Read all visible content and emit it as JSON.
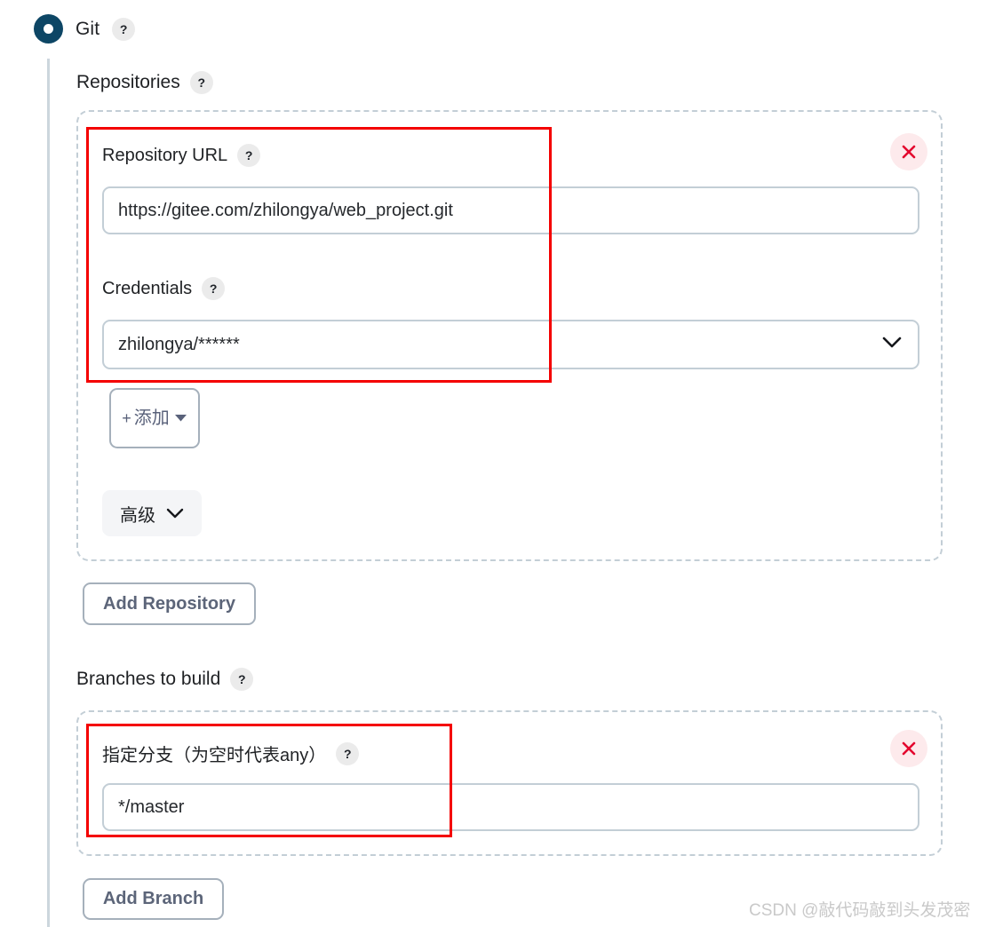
{
  "scm": {
    "selected_label": "Git",
    "help_label": "?",
    "radio_selected": true
  },
  "repositories": {
    "title": "Repositories",
    "help_label": "?",
    "repository": {
      "url_field": {
        "label": "Repository URL",
        "help_label": "?",
        "value": "https://gitee.com/zhilongya/web_project.git",
        "placeholder": ""
      },
      "credentials_field": {
        "label": "Credentials",
        "help_label": "?",
        "selected_option": "zhilongya/******",
        "options": [
          "zhilongya/******"
        ],
        "caret_icon": "chevron-down-icon"
      },
      "add_button": {
        "label": "添加",
        "plus_icon": "plus-icon",
        "caret_icon": "caret-down-icon"
      },
      "advanced_button": {
        "label": "高级",
        "caret_icon": "chevron-down-icon"
      },
      "delete_button": {
        "icon": "close-icon",
        "color": "#e3072e",
        "background": "#fdeaec"
      }
    },
    "add_repository_label": "Add Repository"
  },
  "branches": {
    "title": "Branches to build",
    "help_label": "?",
    "branch": {
      "label": "指定分支（为空时代表any）",
      "help_label": "?",
      "value": "*/master",
      "placeholder": "",
      "delete_button": {
        "icon": "close-icon",
        "color": "#e3072e",
        "background": "#fdeaec"
      }
    },
    "add_branch_label": "Add Branch"
  },
  "annotations": {
    "highlight_color": "#f40000",
    "boxes": [
      "repository-credentials-highlight",
      "branch-specifier-highlight"
    ]
  },
  "watermark": {
    "text": "CSDN @敲代码敲到头发茂密"
  },
  "colors": {
    "radio_selected": "#0d4665",
    "dashed_border": "#c3ced6",
    "input_border": "#c3ced6",
    "button_text": "#5c6579",
    "annotation_red": "#f40000"
  }
}
